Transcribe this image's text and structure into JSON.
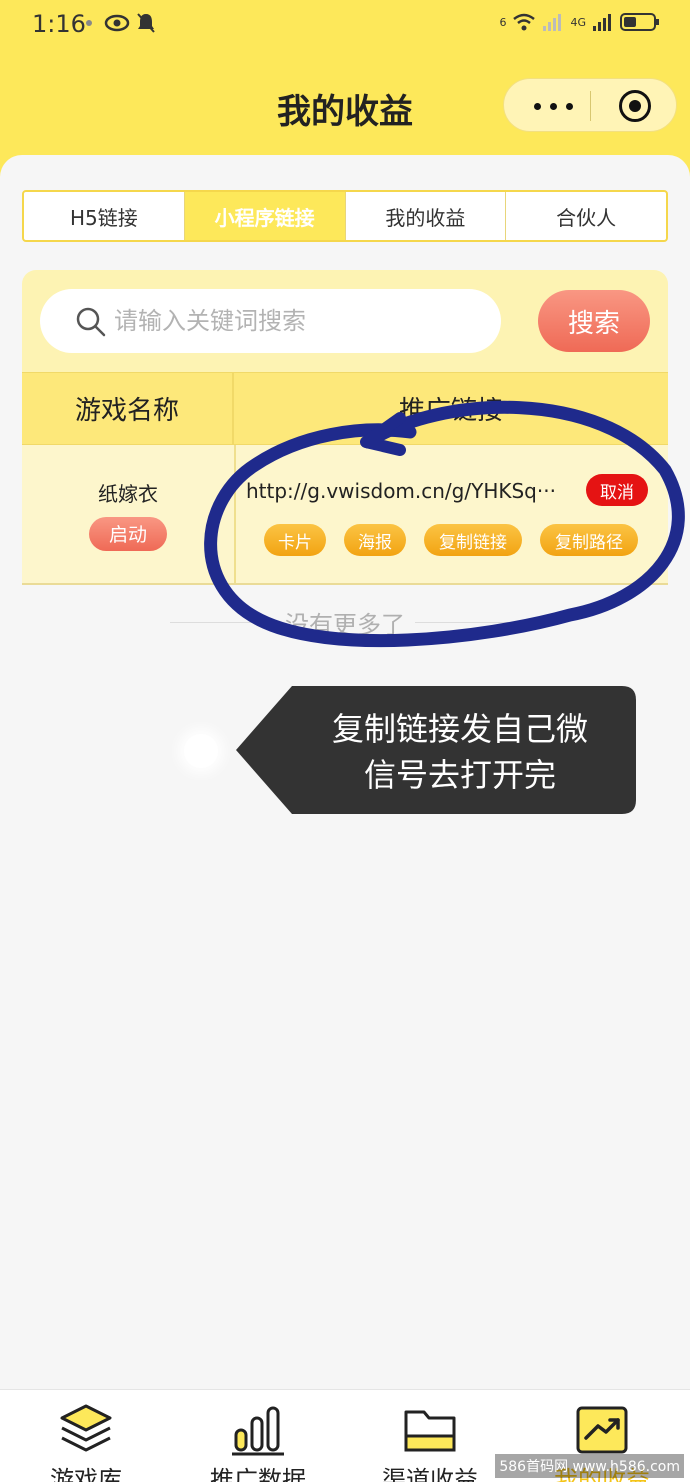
{
  "status_bar": {
    "time": "1:16",
    "network_a": "6",
    "network_b": "4G"
  },
  "header": {
    "title": "我的收益"
  },
  "tabs": [
    {
      "label": "H5链接",
      "active": false
    },
    {
      "label": "小程序链接",
      "active": true
    },
    {
      "label": "我的收益",
      "active": false
    },
    {
      "label": "合伙人",
      "active": false
    }
  ],
  "search": {
    "placeholder": "请输入关键词搜索",
    "button_label": "搜索"
  },
  "table": {
    "headers": [
      "游戏名称",
      "推广链接"
    ],
    "rows": [
      {
        "name": "纸嫁衣",
        "start_label": "启动",
        "link": "http://g.vwisdom.cn/g/YHKSq···",
        "cancel_label": "取消",
        "actions": [
          "卡片",
          "海报",
          "复制链接",
          "复制路径"
        ]
      }
    ]
  },
  "list_end": {
    "text": "没有更多了"
  },
  "annotation": {
    "line1": "复制链接发自己微",
    "line2": "信号去打开完"
  },
  "bottom_nav": [
    {
      "label": "游戏库",
      "icon": "layers-icon",
      "active": false
    },
    {
      "label": "推广数据",
      "icon": "bar-chart-icon",
      "active": false
    },
    {
      "label": "渠道收益",
      "icon": "folder-icon",
      "active": false
    },
    {
      "label": "我的收益",
      "icon": "trend-chart-icon",
      "active": true
    }
  ],
  "watermark": "586首码网 www.h586.com",
  "colors": {
    "theme_yellow": "#fde85a",
    "cancel_red": "#e51313",
    "action_orange": "#f2a312",
    "annotation_blue": "#1f2a8c"
  }
}
